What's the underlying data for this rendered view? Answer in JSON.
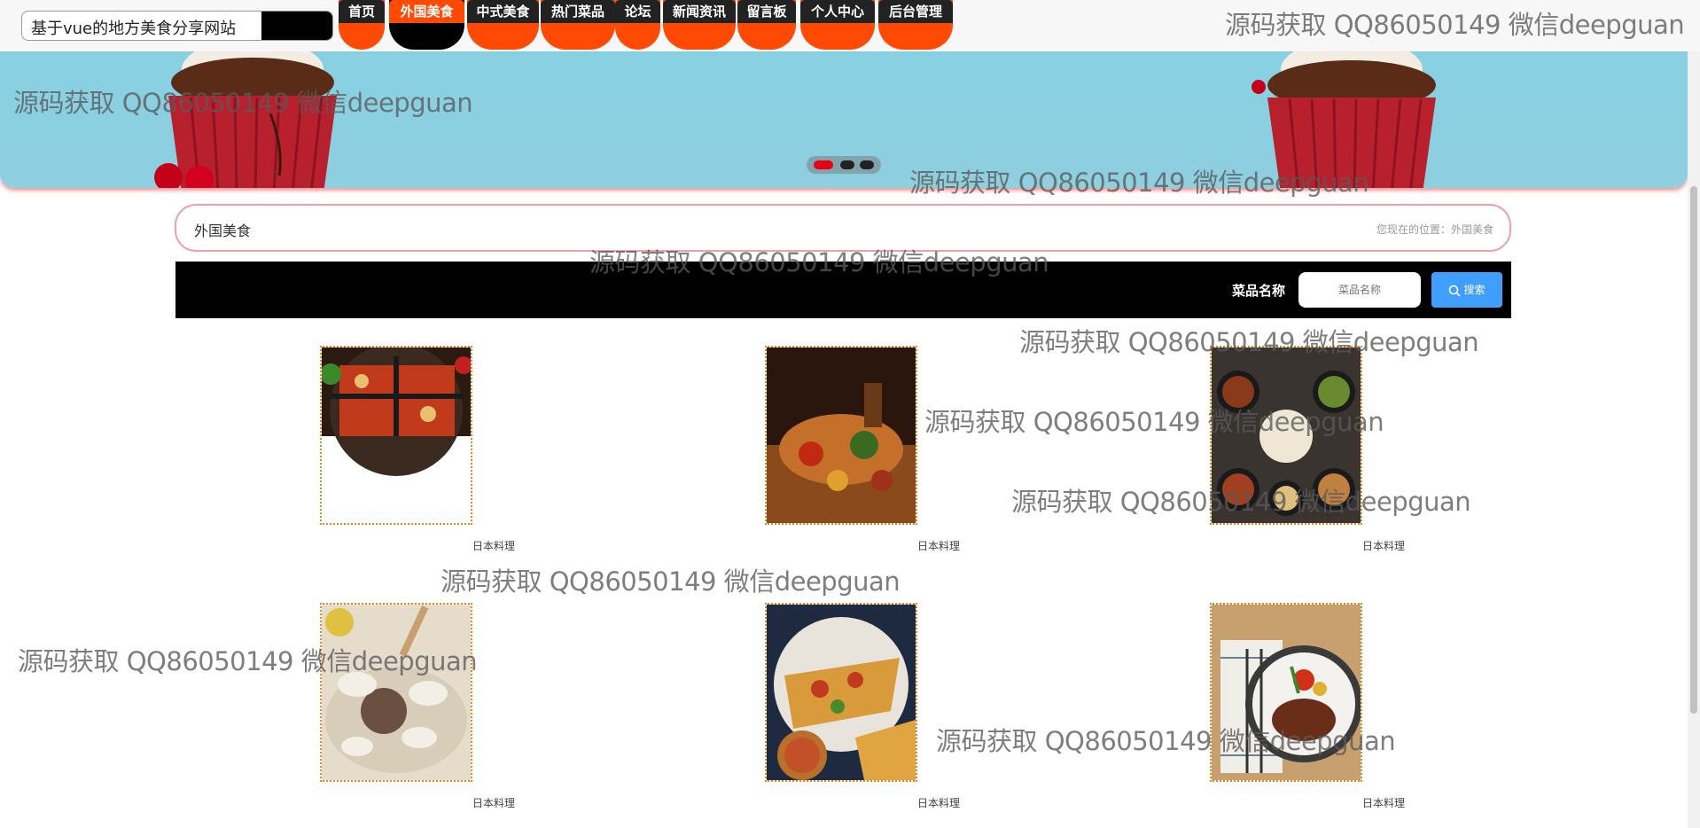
{
  "site": {
    "title": "基于vue的地方美食分享网站"
  },
  "nav": [
    {
      "label": "首页",
      "active": false
    },
    {
      "label": "外国美食",
      "active": true
    },
    {
      "label": "中式美食",
      "active": false
    },
    {
      "label": "热门菜品",
      "active": false
    },
    {
      "label": "论坛",
      "active": false
    },
    {
      "label": "新闻资讯",
      "active": false
    },
    {
      "label": "留言板",
      "active": false
    },
    {
      "label": "个人中心",
      "active": false
    },
    {
      "label": "后台管理",
      "active": false
    }
  ],
  "banner": {
    "active_slide": 1,
    "slide_count": 3
  },
  "breadcrumb": {
    "title": "外国美食",
    "position": "您现在的位置：外国美食"
  },
  "search": {
    "label": "菜品名称",
    "placeholder": "菜品名称",
    "button": "搜索"
  },
  "items": [
    {
      "name": "日本料理"
    },
    {
      "name": "日本料理"
    },
    {
      "name": "日本料理"
    },
    {
      "name": "日本料理"
    },
    {
      "name": "日本料理"
    },
    {
      "name": "日本料理"
    }
  ],
  "watermark": "源码获取 QQ86050149 微信deepguan",
  "colors": {
    "accent": "#ff4a06",
    "button_blue": "#409eff",
    "breadcrumb_border": "#f0a0a8"
  }
}
